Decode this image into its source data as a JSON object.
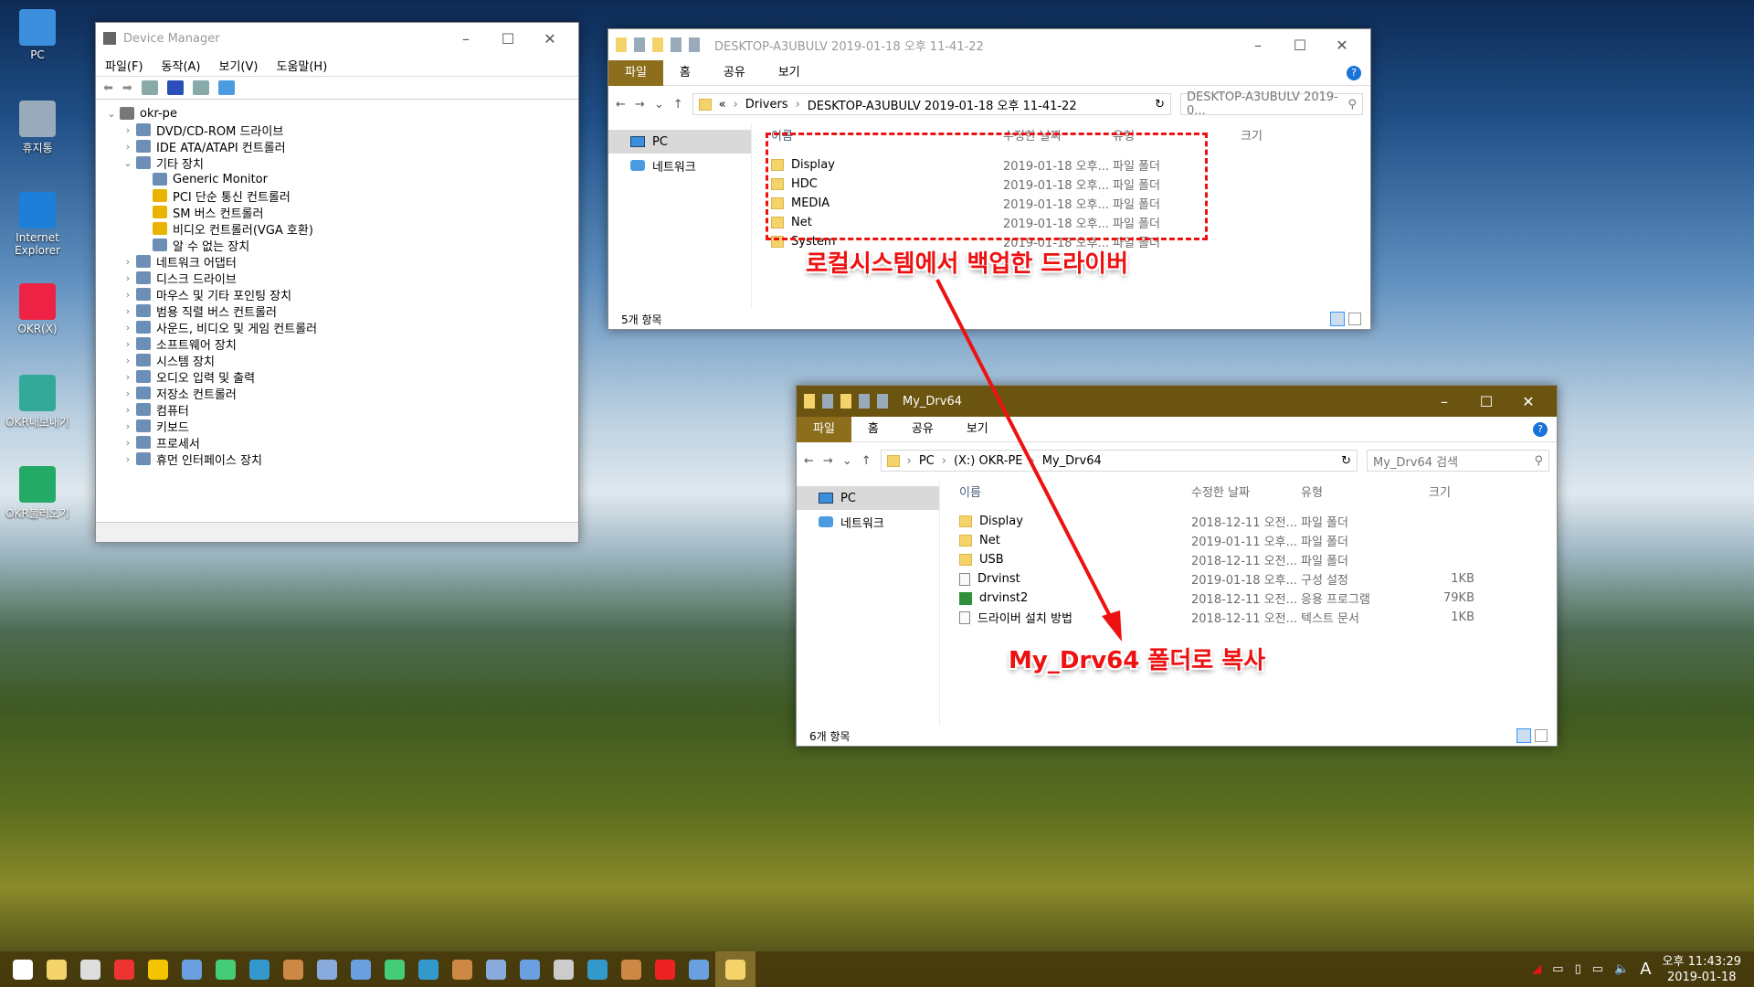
{
  "desktop": {
    "icons": [
      "PC",
      "휴지통",
      "Internet Explorer",
      "OKR(X)",
      "OKR내보내기",
      "OKR불러오기"
    ]
  },
  "device_manager": {
    "title": "Device Manager",
    "menu": [
      "파일(F)",
      "동작(A)",
      "보기(V)",
      "도움말(H)"
    ],
    "root": "okr-pe",
    "tree": [
      {
        "label": "DVD/CD-ROM 드라이브",
        "level": 1,
        "expand": "collapsed"
      },
      {
        "label": "IDE ATA/ATAPI 컨트롤러",
        "level": 1,
        "expand": "collapsed"
      },
      {
        "label": "기타 장치",
        "level": 1,
        "expand": "expanded"
      },
      {
        "label": "Generic Monitor",
        "level": 2,
        "expand": "none"
      },
      {
        "label": "PCI 단순 통신 컨트롤러",
        "level": 2,
        "expand": "none",
        "warning": true
      },
      {
        "label": "SM 버스 컨트롤러",
        "level": 2,
        "expand": "none",
        "warning": true
      },
      {
        "label": "비디오 컨트롤러(VGA 호환)",
        "level": 2,
        "expand": "none",
        "warning": true
      },
      {
        "label": "알 수 없는 장치",
        "level": 2,
        "expand": "none"
      },
      {
        "label": "네트워크 어댑터",
        "level": 1,
        "expand": "collapsed"
      },
      {
        "label": "디스크 드라이브",
        "level": 1,
        "expand": "collapsed"
      },
      {
        "label": "마우스 및 기타 포인팅 장치",
        "level": 1,
        "expand": "collapsed"
      },
      {
        "label": "범용 직렬 버스 컨트롤러",
        "level": 1,
        "expand": "collapsed"
      },
      {
        "label": "사운드, 비디오 및 게임 컨트롤러",
        "level": 1,
        "expand": "collapsed"
      },
      {
        "label": "소프트웨어 장치",
        "level": 1,
        "expand": "collapsed"
      },
      {
        "label": "시스템 장치",
        "level": 1,
        "expand": "collapsed"
      },
      {
        "label": "오디오 입력 및 출력",
        "level": 1,
        "expand": "collapsed"
      },
      {
        "label": "저장소 컨트롤러",
        "level": 1,
        "expand": "collapsed"
      },
      {
        "label": "컴퓨터",
        "level": 1,
        "expand": "collapsed"
      },
      {
        "label": "키보드",
        "level": 1,
        "expand": "collapsed"
      },
      {
        "label": "프로세서",
        "level": 1,
        "expand": "collapsed"
      },
      {
        "label": "휴먼 인터페이스 장치",
        "level": 1,
        "expand": "collapsed"
      }
    ]
  },
  "explorer1": {
    "title": "DESKTOP-A3UBULV 2019-01-18 오후 11-41-22",
    "ribbon": [
      "파일",
      "홈",
      "공유",
      "보기"
    ],
    "path": [
      "«",
      "Drivers",
      "DESKTOP-A3UBULV 2019-01-18 오후 11-41-22"
    ],
    "search_placeholder": "DESKTOP-A3UBULV 2019-0...",
    "nav": [
      "PC",
      "네트워크"
    ],
    "columns": [
      "이름",
      "수정한 날짜",
      "유형",
      "크기"
    ],
    "files": [
      {
        "name": "Display",
        "date": "2019-01-18 오후...",
        "type": "파일 폴더",
        "size": "",
        "icon": "folder"
      },
      {
        "name": "HDC",
        "date": "2019-01-18 오후...",
        "type": "파일 폴더",
        "size": "",
        "icon": "folder"
      },
      {
        "name": "MEDIA",
        "date": "2019-01-18 오후...",
        "type": "파일 폴더",
        "size": "",
        "icon": "folder"
      },
      {
        "name": "Net",
        "date": "2019-01-18 오후...",
        "type": "파일 폴더",
        "size": "",
        "icon": "folder"
      },
      {
        "name": "System",
        "date": "2019-01-18 오후...",
        "type": "파일 폴더",
        "size": "",
        "icon": "folder"
      }
    ],
    "status": "5개 항목"
  },
  "explorer2": {
    "title": "My_Drv64",
    "ribbon": [
      "파일",
      "홈",
      "공유",
      "보기"
    ],
    "path": [
      "PC",
      "(X:) OKR-PE",
      "My_Drv64"
    ],
    "search_placeholder": "My_Drv64 검색",
    "nav": [
      "PC",
      "네트워크"
    ],
    "columns": [
      "이름",
      "수정한 날짜",
      "유형",
      "크기"
    ],
    "files": [
      {
        "name": "Display",
        "date": "2018-12-11 오전...",
        "type": "파일 폴더",
        "size": "",
        "icon": "folder"
      },
      {
        "name": "Net",
        "date": "2019-01-11 오후...",
        "type": "파일 폴더",
        "size": "",
        "icon": "folder"
      },
      {
        "name": "USB",
        "date": "2018-12-11 오전...",
        "type": "파일 폴더",
        "size": "",
        "icon": "folder"
      },
      {
        "name": "Drvinst",
        "date": "2019-01-18 오후...",
        "type": "구성 설정",
        "size": "1KB",
        "icon": "config"
      },
      {
        "name": "drvinst2",
        "date": "2018-12-11 오전...",
        "type": "응용 프로그램",
        "size": "79KB",
        "icon": "exe"
      },
      {
        "name": "드라이버 설치 방법",
        "date": "2018-12-11 오전...",
        "type": "텍스트 문서",
        "size": "1KB",
        "icon": "text"
      }
    ],
    "status": "6개 항목"
  },
  "annotations": {
    "note1": "로컬시스템에서 백업한 드라이버",
    "note2": "My_Drv64 폴더로 복사",
    "color": "#ee1111"
  },
  "taskbar": {
    "icons": [
      "start",
      "file-explorer",
      "capture",
      "anydesk",
      "potplayer",
      "app",
      "app",
      "app",
      "app",
      "app",
      "app",
      "app",
      "app",
      "app",
      "app",
      "app",
      "tools",
      "app",
      "app",
      "close-red",
      "app",
      "file-explorer-active"
    ],
    "tray": {
      "ime": "A",
      "time": "오후 11:43:29",
      "date": "2019-01-18"
    }
  }
}
